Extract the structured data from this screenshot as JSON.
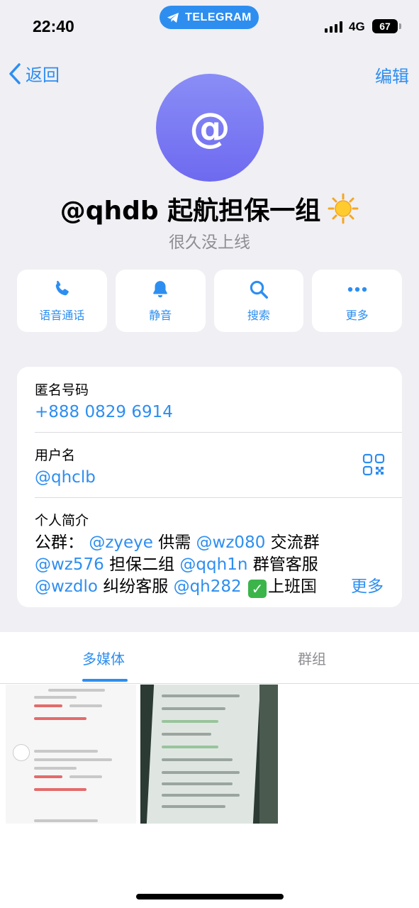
{
  "status_bar": {
    "time": "22:40",
    "app_pill": "TELEGRAM",
    "network": "4G",
    "battery": "67"
  },
  "nav": {
    "back_label": "返回",
    "edit_label": "编辑"
  },
  "profile": {
    "avatar_glyph": "@",
    "name": "@qhdb 起航担保一组",
    "last_seen": "很久没上线"
  },
  "actions": [
    {
      "label": "语音通话",
      "icon": "phone-icon"
    },
    {
      "label": "静音",
      "icon": "bell-icon"
    },
    {
      "label": "搜索",
      "icon": "search-icon"
    },
    {
      "label": "更多",
      "icon": "more-icon"
    }
  ],
  "info": {
    "phone_label": "匿名号码",
    "phone_value": "+888 0829 6914",
    "username_label": "用户名",
    "username_value": "@qhclb",
    "bio_label": "个人简介",
    "bio": {
      "l1a": "公群：",
      "l1b": "@zyeye",
      "l1c": "供需",
      "l1d": "@wz080",
      "l1e": "交流群",
      "l2a": "@wz576",
      "l2b": "担保二组",
      "l2c": "@qqh1n",
      "l2d": "群管客服",
      "l3a": "@wzdlo",
      "l3b": "纠纷客服",
      "l3c": "@qh282",
      "l3d": "上班国"
    },
    "more_label": "更多"
  },
  "tabs": {
    "media": "多媒体",
    "groups": "群组"
  },
  "colors": {
    "accent": "#2d8ef0",
    "background": "#efeff4"
  }
}
